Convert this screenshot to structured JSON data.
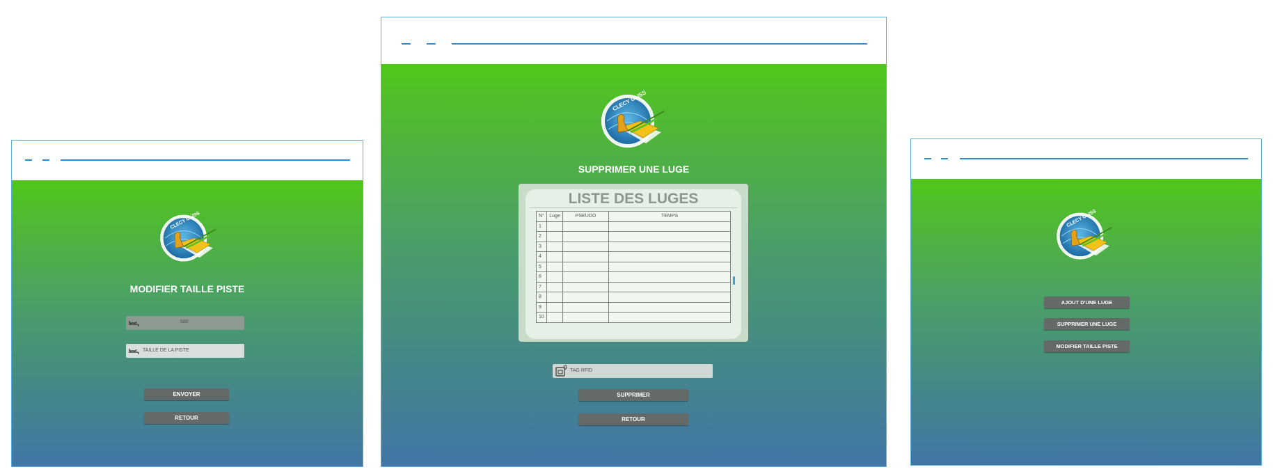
{
  "colors": {
    "frame_border": "#5aaee3",
    "header_dash": "#2a8fd6",
    "gradient_top": "#50c71a",
    "gradient_bottom": "#4276a6",
    "button_bg": "#646a68",
    "panel_bg": "#c8dcc9"
  },
  "logo": {
    "text": "CLECY GLISS",
    "icon": "clecy-gliss-logo"
  },
  "left_screen": {
    "title": "MODIFIER TAILLE PISTE",
    "current_value": "680",
    "value_icon": "sled-icon",
    "input_placeholder": "TAILLE DE LA PISTE",
    "input_icon": "sled-icon",
    "send_label": "ENVOYER",
    "back_label": "RETOUR"
  },
  "center_screen": {
    "title": "SUPPRIMER UNE LUGE",
    "list_title": "LISTE DES LUGES",
    "table": {
      "headers": [
        "N°",
        "Luge",
        "PSEUDO",
        "TEMPS"
      ],
      "rows": [
        {
          "num": "1",
          "luge": "",
          "pseudo": "",
          "temps": ""
        },
        {
          "num": "2",
          "luge": "",
          "pseudo": "",
          "temps": ""
        },
        {
          "num": "3",
          "luge": "",
          "pseudo": "",
          "temps": ""
        },
        {
          "num": "4",
          "luge": "",
          "pseudo": "",
          "temps": ""
        },
        {
          "num": "5",
          "luge": "",
          "pseudo": "",
          "temps": ""
        },
        {
          "num": "6",
          "luge": "",
          "pseudo": "",
          "temps": ""
        },
        {
          "num": "7",
          "luge": "",
          "pseudo": "",
          "temps": ""
        },
        {
          "num": "8",
          "luge": "",
          "pseudo": "",
          "temps": ""
        },
        {
          "num": "9",
          "luge": "",
          "pseudo": "",
          "temps": ""
        },
        {
          "num": "10",
          "luge": "",
          "pseudo": "",
          "temps": ""
        }
      ]
    },
    "rfid_placeholder": "TAG RFID",
    "rfid_icon": "rfid-tag-icon",
    "delete_label": "SUPPRIMER",
    "back_label": "RETOUR"
  },
  "right_screen": {
    "menu": [
      "AJOUT D'UNE LUGE",
      "SUPPRIMER UNE LUGE",
      "MODIFIER TAILLE PISTE"
    ]
  }
}
